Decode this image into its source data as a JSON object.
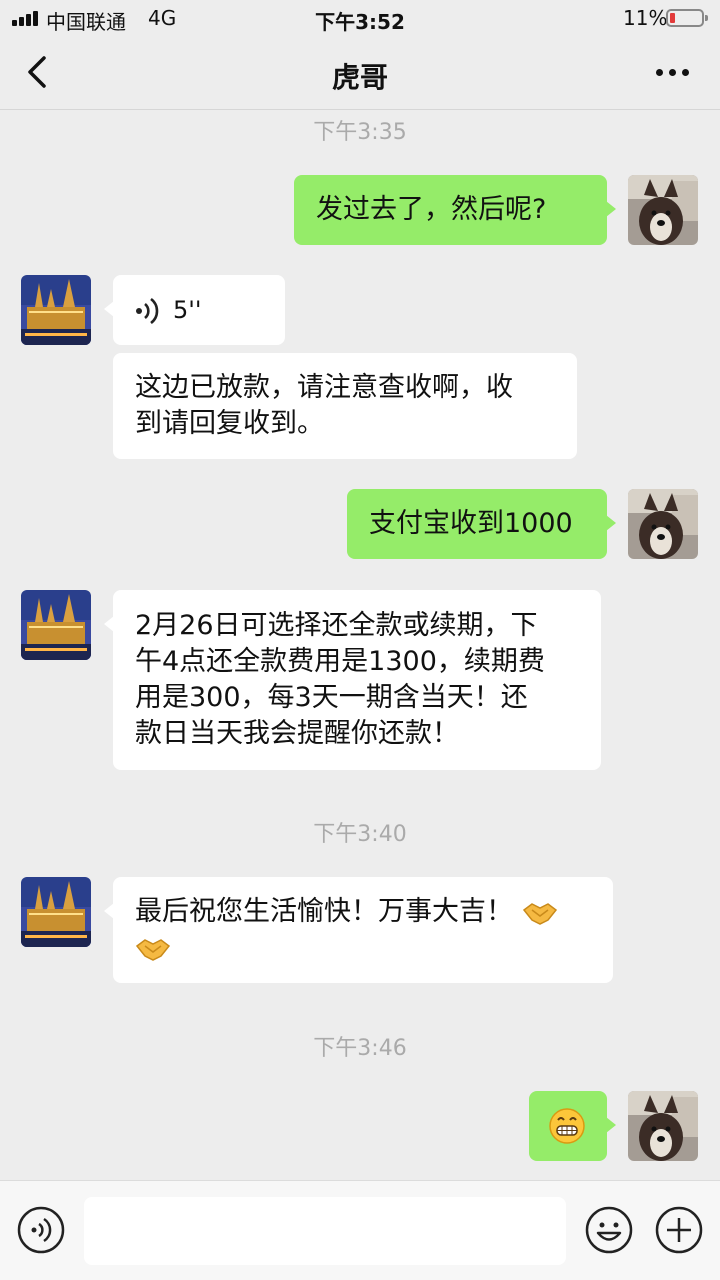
{
  "status_bar": {
    "carrier": "中国联通",
    "network": "4G",
    "time": "下午3:52",
    "battery_percent": "11%",
    "battery_level": 0.11
  },
  "nav": {
    "title": "虎哥"
  },
  "times": {
    "t1": "下午3:35",
    "t2": "下午3:40",
    "t3": "下午3:46"
  },
  "messages": {
    "m1": "发过去了，然后呢?",
    "m2_voice_duration": "5''",
    "m3_line1": "这边已放款，请注意查收啊，收",
    "m3_line2": "到请回复收到。",
    "m4": "支付宝收到1000",
    "m5_line1": "2月26日可选择还全款或续期，下",
    "m5_line2": "午4点还全款费用是1300，续期费",
    "m5_line3": "用是300，每3天一期含当天！还",
    "m5_line4": "款日当天我会提醒你还款！",
    "m6_text": "最后祝您生活愉快！万事大吉！",
    "m6_emojis": [
      "handshake",
      "handshake"
    ],
    "m7_emoji": "grinning-face"
  },
  "icons": {
    "back": "chevron-left-icon",
    "more": "more-dots-icon",
    "voice": "voice-wave-icon",
    "emoji": "emoji-face-icon",
    "plus": "plus-icon"
  },
  "colors": {
    "outgoing_bubble": "#95ec69",
    "incoming_bubble": "#ffffff",
    "background": "#ededed",
    "battery_low": "#e23a3a"
  }
}
